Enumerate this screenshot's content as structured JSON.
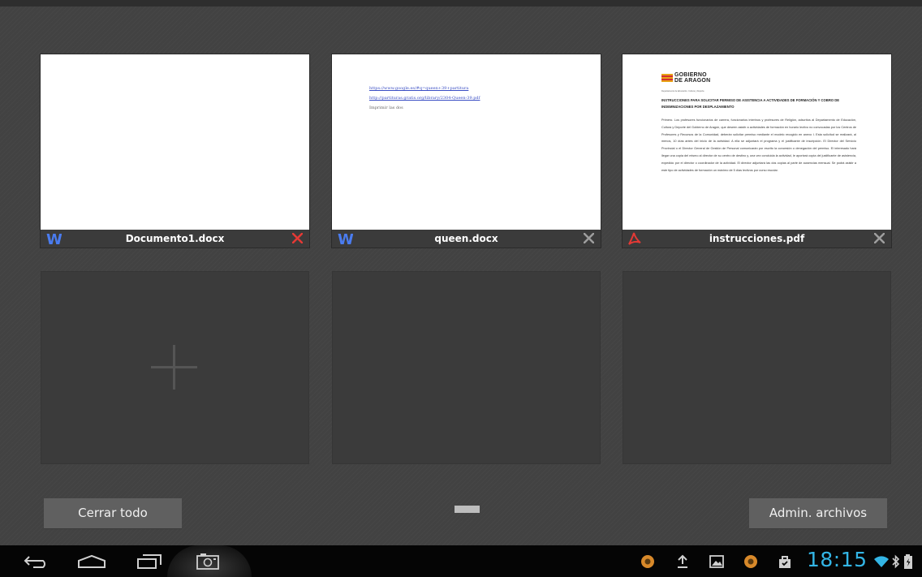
{
  "tabs": [
    {
      "name": "Documento1.docx",
      "type": "word",
      "close_color": "#e53935"
    },
    {
      "name": "queen.docx",
      "type": "word",
      "close_color": "#9e9e9e",
      "preview": {
        "link1": "https://www.google.es/#q=queen+39+partitura",
        "link2": "http://partituras.gratis.org/library/2304-Queen-39.pdf",
        "text": "Imprimir las dos"
      }
    },
    {
      "name": "instrucciones.pdf",
      "type": "pdf",
      "close_color": "#9e9e9e",
      "preview": {
        "logo_line1": "GOBIERNO",
        "logo_line2": "DE ARAGON",
        "dept": "Departamento de Educación, Cultura y Deporte",
        "title": "INSTRUCCIONES PARA SOLICITAR PERMISO DE ASISTENCIA A ACTIVIDADES DE FORMACIÓN Y COBRO DE INDEMNIZACIONES POR DESPLAZAMIENTO",
        "body": "Primero. Los profesores funcionarios de carrera, funcionarios interinos y profesores de Religión, adscritos al Departamento de Educación, Cultura y Deporte del Gobierno de Aragón, que deseen asistir a actividades de formación en horario lectivo no convocadas por los Centros de Profesores y Recursos de la Comunidad, deberán solicitar permiso mediante el modelo recogido en anexo I. Esta solicitud se realizará, al menos, 10 días antes del inicio de la actividad. A ella se adjuntará el programa y el justificante de inscripción. El Director del Servicio Provincial o el Director General de Gestión de Personal comunicarán por escrito la concesión o denegación del permiso. El interesado hará llegar una copia del mismo al director de su centro de destino y, una vez concluida la actividad, le aportará copia del justificante de asistencia, expedido por el director o coordinador de la actividad. El director adjuntará las dos copias al parte de ausencias mensual. Se podrá asistir a este tipo de actividades de formación un máximo de 5 días lectivos por curso escolar."
      }
    }
  ],
  "buttons": {
    "close_all": "Cerrar todo",
    "file_manager": "Admin. archivos"
  },
  "status": {
    "time": "18:15"
  },
  "colors": {
    "accent": "#33b5e5",
    "word_icon": "#4a7cf0",
    "pdf_icon": "#e53935"
  }
}
